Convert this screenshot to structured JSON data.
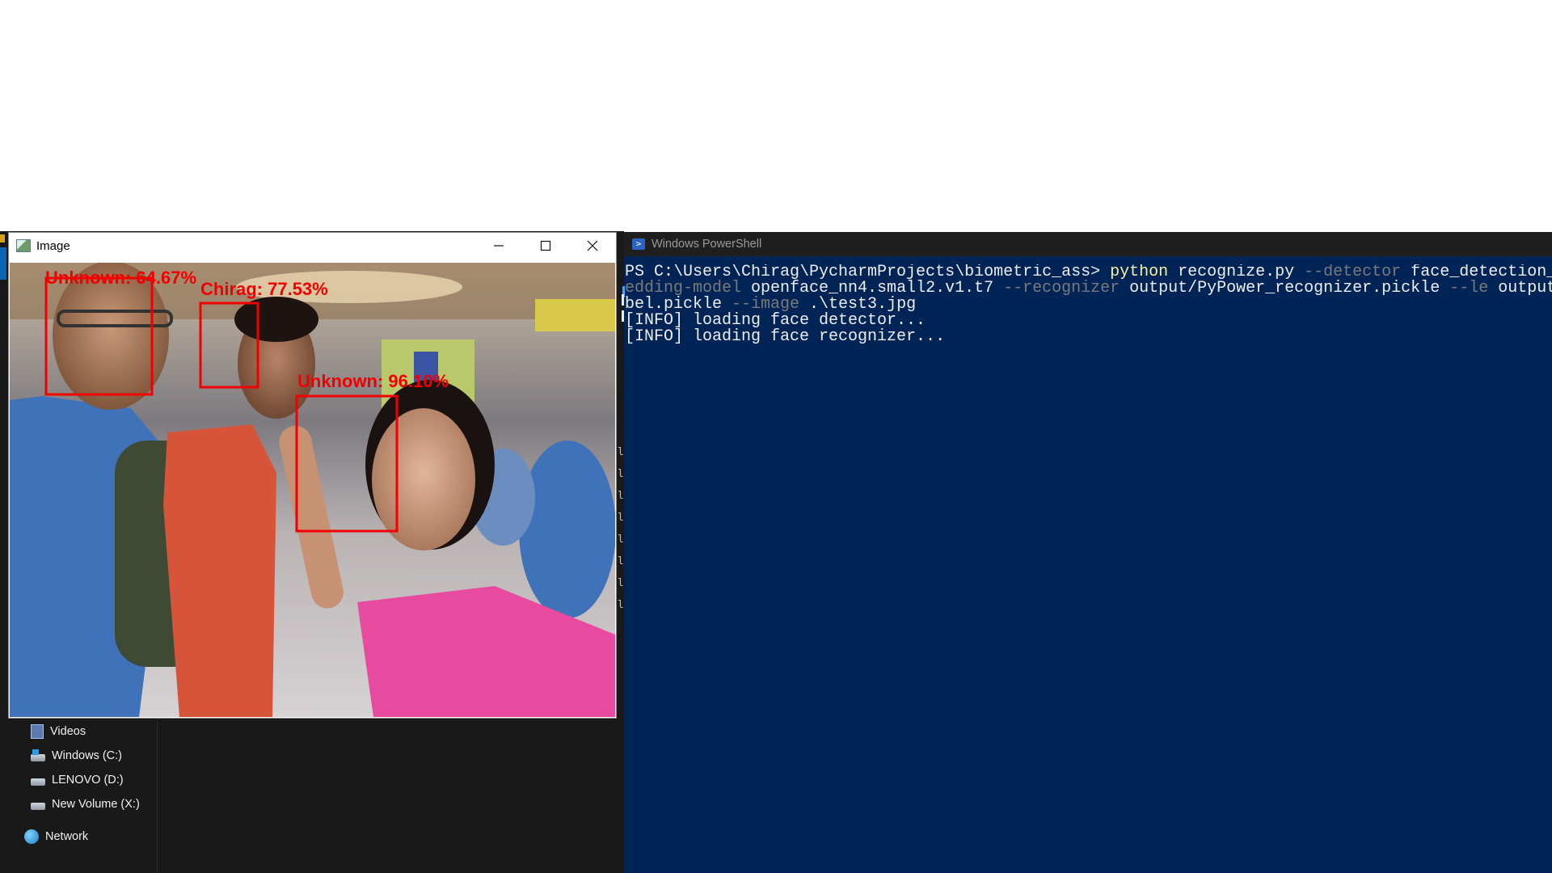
{
  "explorer": {
    "nav_items": [
      {
        "label": "Videos",
        "icon": "videos-folder-icon"
      },
      {
        "label": "Windows (C:)",
        "icon": "windows-drive-icon"
      },
      {
        "label": "LENOVO (D:)",
        "icon": "drive-icon"
      },
      {
        "label": "New Volume (X:)",
        "icon": "drive-icon"
      },
      {
        "label": "Network",
        "icon": "network-icon"
      }
    ],
    "side_letters": [
      "le",
      "le",
      "le",
      "le",
      "le",
      "le",
      "le",
      "le"
    ]
  },
  "image_window": {
    "title": "Image",
    "detections": [
      {
        "label": "Unknown: 64.67%",
        "color": "#f20000"
      },
      {
        "label": "Chirag: 77.53%",
        "color": "#f20000"
      },
      {
        "label": "Unknown: 96.10%",
        "color": "#f20000"
      }
    ]
  },
  "powershell": {
    "title": "Windows PowerShell",
    "lines": [
      [
        {
          "t": "PS C:\\Users\\Chirag\\PycharmProjects\\biometric_ass> ",
          "c": "w"
        },
        {
          "t": "python",
          "c": "y"
        },
        {
          "t": " recognize.py ",
          "c": "w"
        },
        {
          "t": "--detector",
          "c": "g"
        },
        {
          "t": " face_detection_",
          "c": "w"
        }
      ],
      [
        {
          "t": "edding-model",
          "c": "g"
        },
        {
          "t": " openface_nn4.small2.v1.t7 ",
          "c": "w"
        },
        {
          "t": "--recognizer",
          "c": "g"
        },
        {
          "t": " output/PyPower_recognizer.pickle ",
          "c": "w"
        },
        {
          "t": "--le",
          "c": "g"
        },
        {
          "t": " output",
          "c": "w"
        }
      ],
      [
        {
          "t": "bel.pickle ",
          "c": "w"
        },
        {
          "t": "--image",
          "c": "g"
        },
        {
          "t": " .\\test3.jpg",
          "c": "w"
        }
      ],
      [
        {
          "t": "[INFO] loading face detector...",
          "c": "w"
        }
      ],
      [
        {
          "t": "[INFO] loading face recognizer...",
          "c": "w"
        }
      ]
    ]
  }
}
